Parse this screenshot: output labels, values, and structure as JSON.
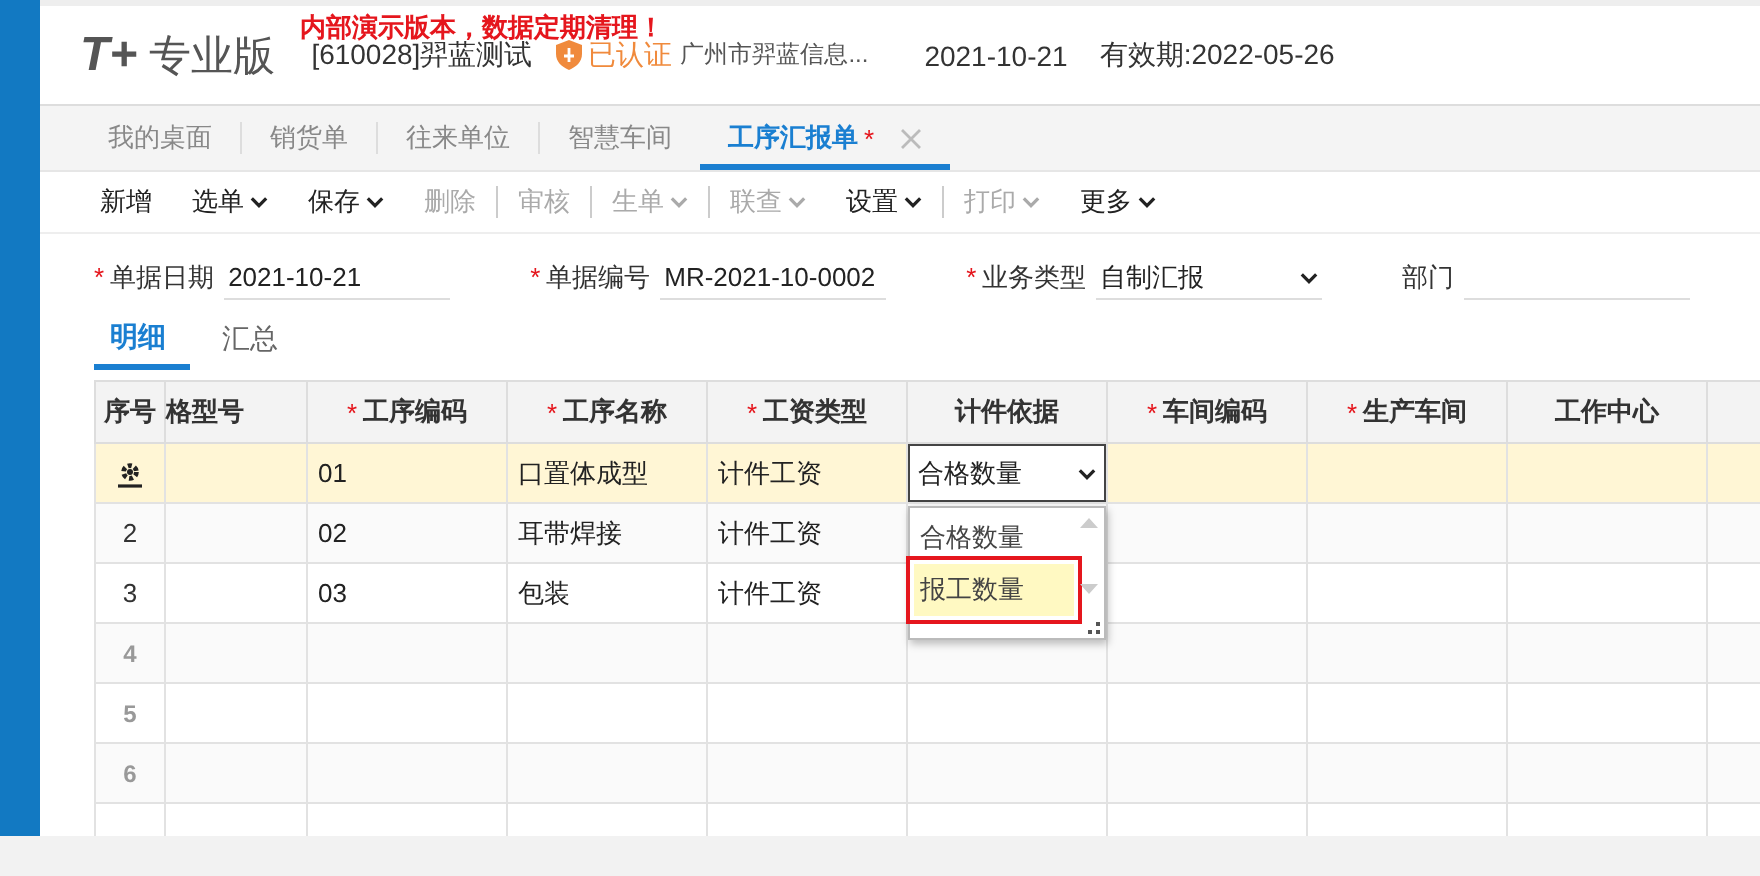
{
  "header": {
    "logo_mark": "T+",
    "logo_text": "专业版",
    "notice": "内部演示版本，数据定期清理！",
    "account": "[610028]羿蓝测试",
    "certified": "已认证",
    "company": "广州市羿蓝信息...",
    "date": "2021-10-21",
    "expiry": "有效期:2022-05-26"
  },
  "tabs": [
    {
      "label": "我的桌面",
      "selected": false,
      "closable": false
    },
    {
      "label": "销货单",
      "selected": false,
      "closable": false
    },
    {
      "label": "往来单位",
      "selected": false,
      "closable": false
    },
    {
      "label": "智慧车间",
      "selected": false,
      "closable": false
    },
    {
      "label": "工序汇报单",
      "marker": "*",
      "selected": true,
      "closable": true
    }
  ],
  "toolbar": [
    {
      "label": "新增",
      "dropdown": false,
      "disabled": false,
      "divider_before": false
    },
    {
      "label": "选单",
      "dropdown": true,
      "disabled": false,
      "divider_before": false
    },
    {
      "label": "保存",
      "dropdown": true,
      "disabled": false,
      "divider_before": false
    },
    {
      "label": "删除",
      "dropdown": false,
      "disabled": true,
      "divider_before": false
    },
    {
      "label": "审核",
      "dropdown": false,
      "disabled": true,
      "divider_before": true
    },
    {
      "label": "生单",
      "dropdown": true,
      "disabled": true,
      "divider_before": true
    },
    {
      "label": "联查",
      "dropdown": true,
      "disabled": true,
      "divider_before": true
    },
    {
      "label": "设置",
      "dropdown": true,
      "disabled": false,
      "divider_before": false
    },
    {
      "label": "打印",
      "dropdown": true,
      "disabled": true,
      "divider_before": true
    },
    {
      "label": "更多",
      "dropdown": true,
      "disabled": false,
      "divider_before": false
    }
  ],
  "form": [
    {
      "marker": "*",
      "label": "单据日期",
      "value": "2021-10-21",
      "kind": "text"
    },
    {
      "marker": "*",
      "label": "单据编号",
      "value": "MR-2021-10-0002",
      "kind": "text"
    },
    {
      "marker": "*",
      "label": "业务类型",
      "value": "自制汇报",
      "kind": "select"
    },
    {
      "label": "部门",
      "kind": "text"
    }
  ],
  "detail_tabs": [
    {
      "label": "明细",
      "selected": true
    },
    {
      "label": "汇总",
      "selected": false
    }
  ],
  "table": {
    "columns": [
      {
        "label": "序号"
      },
      {
        "label": "格型号"
      },
      {
        "marker": "*",
        "label": "工序编码"
      },
      {
        "marker": "*",
        "label": "工序名称"
      },
      {
        "marker": "*",
        "label": "工资类型"
      },
      {
        "label": "计件依据"
      },
      {
        "marker": "*",
        "label": "车间编码"
      },
      {
        "marker": "*",
        "label": "生产车间"
      },
      {
        "label": "工作中心"
      },
      {}
    ],
    "rows": [
      {
        "kind": "editing",
        "selected": true,
        "cells": [
          "",
          "01",
          "口置体成型",
          "计件工资",
          "合格数量",
          "",
          "",
          "",
          ""
        ]
      },
      {
        "kind": "normal",
        "no": "2",
        "selected": false,
        "cells": [
          "",
          "02",
          "耳带焊接",
          "计件工资",
          "",
          "",
          "",
          "",
          ""
        ]
      },
      {
        "kind": "normal",
        "no": "3",
        "selected": false,
        "cells": [
          "",
          "03",
          "包装",
          "计件工资",
          "",
          "",
          "",
          "",
          ""
        ]
      },
      {
        "kind": "empty",
        "no": "4",
        "selected": false
      },
      {
        "kind": "empty",
        "no": "5",
        "selected": false
      },
      {
        "kind": "empty",
        "no": "6",
        "selected": false
      },
      {
        "kind": "empty",
        "selected": false
      }
    ],
    "dropdown": {
      "options": [
        {
          "label": "合格数量",
          "selected": false
        },
        {
          "label": "报工数量",
          "selected": true
        }
      ]
    }
  }
}
